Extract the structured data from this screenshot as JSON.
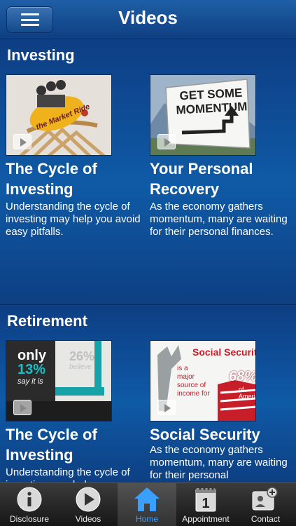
{
  "header": {
    "title": "Videos",
    "menu_icon": "hamburger-icon"
  },
  "sections": [
    {
      "title": "Investing",
      "cards": [
        {
          "title": "The Cycle of Investing",
          "title_line1": "The Cycle of",
          "title_line2": "Investing",
          "description": "Understanding the cycle of investing may help you avoid easy pitfalls.",
          "thumb_text": "the Market Ride"
        },
        {
          "title": "Your Personal Recovery",
          "title_line1": "Your Personal",
          "title_line2": "Recovery",
          "description": "As the economy gathers momentum, many are waiting for their personal finances.",
          "thumb_text_1": "GET SOME",
          "thumb_text_2": "MOMENTUM"
        }
      ]
    },
    {
      "title": "Retirement",
      "cards": [
        {
          "title": "The Cycle of Investing",
          "title_line1": "The Cycle of",
          "title_line2": "Investing",
          "description": "Understanding the cycle of investing may help you",
          "thumb_only": "only",
          "thumb_pct": "13%",
          "thumb_say": "say it is",
          "thumb_pct2": "26%",
          "thumb_believe": "believe"
        },
        {
          "title": "Social Security",
          "description": "As the economy gathers momentum, many are waiting for their personal",
          "thumb_heading": "Social Securit",
          "thumb_is": "is a",
          "thumb_major": "major",
          "thumb_source": "source of",
          "thumb_income": "income for",
          "thumb_pct": "68%",
          "thumb_of": "of",
          "thumb_americans": "Americ"
        }
      ]
    }
  ],
  "tabbar": {
    "tabs": [
      {
        "label": "Disclosure",
        "icon": "info-icon"
      },
      {
        "label": "Videos",
        "icon": "play-icon"
      },
      {
        "label": "Home",
        "icon": "home-icon"
      },
      {
        "label": "Appointment",
        "icon": "calendar-icon",
        "icon_text": "1"
      },
      {
        "label": "Contact",
        "icon": "add-contact-icon"
      }
    ],
    "active": "Home",
    "active_color": "#3aa0ff"
  }
}
